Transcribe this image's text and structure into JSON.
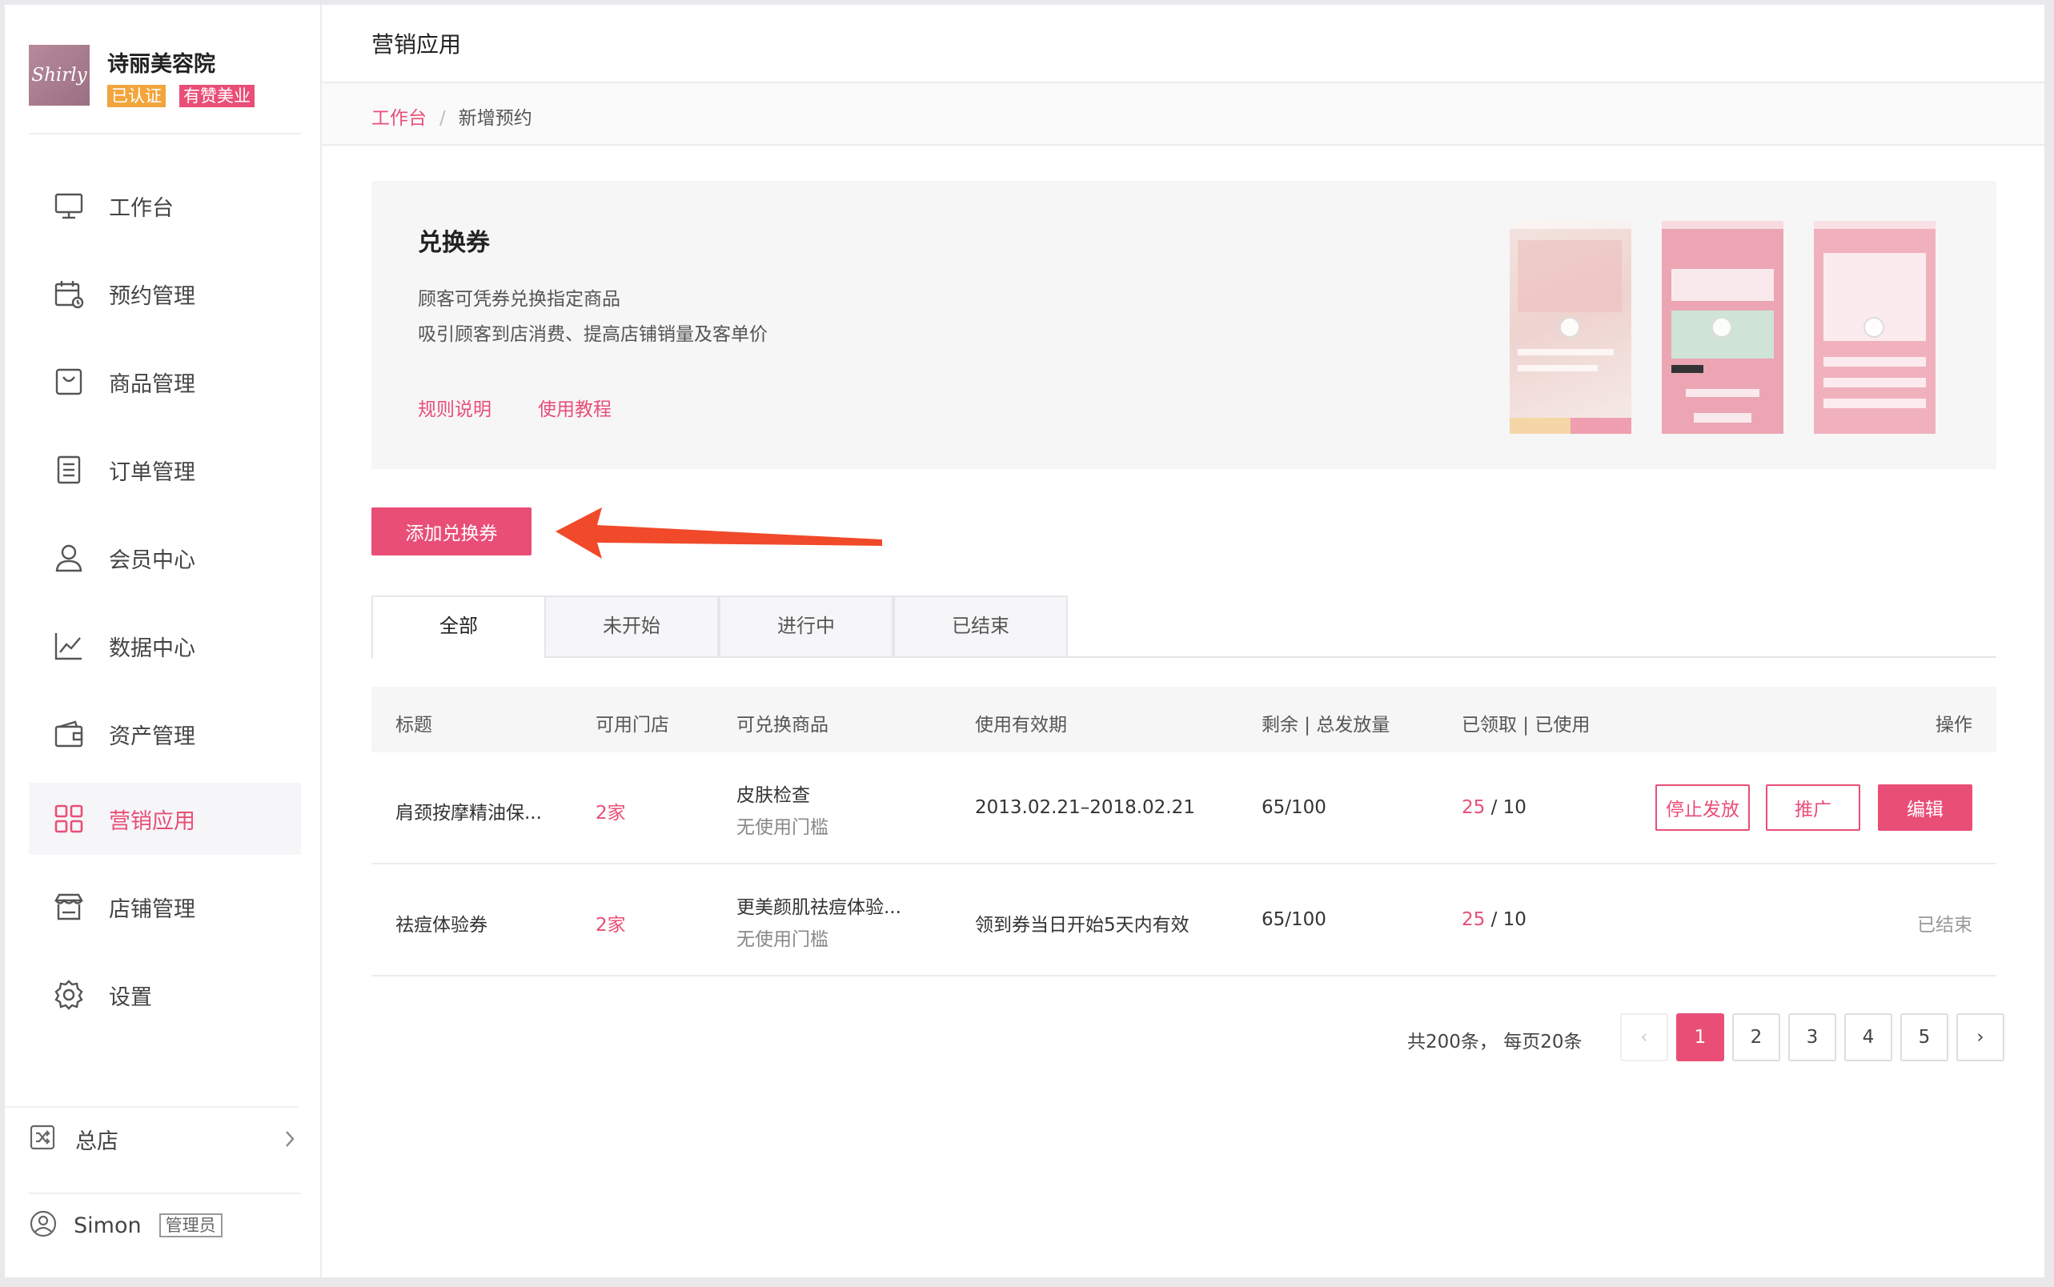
{
  "brand": {
    "logo_text": "Shirly",
    "name": "诗丽美容院",
    "badges": [
      "已认证",
      "有赞美业"
    ]
  },
  "sidebar": {
    "items": [
      {
        "label": "工作台",
        "icon": "monitor-icon"
      },
      {
        "label": "预约管理",
        "icon": "calendar-icon"
      },
      {
        "label": "商品管理",
        "icon": "bag-icon"
      },
      {
        "label": "订单管理",
        "icon": "document-icon"
      },
      {
        "label": "会员中心",
        "icon": "user-icon"
      },
      {
        "label": "数据中心",
        "icon": "chart-icon"
      },
      {
        "label": "资产管理",
        "icon": "wallet-icon"
      },
      {
        "label": "营销应用",
        "icon": "apps-icon",
        "active": true
      },
      {
        "label": "店铺管理",
        "icon": "store-icon"
      },
      {
        "label": "设置",
        "icon": "gear-icon"
      }
    ],
    "store": "总店",
    "user": {
      "name": "Simon",
      "role": "管理员"
    }
  },
  "header": {
    "title": "营销应用"
  },
  "breadcrumb": {
    "home": "工作台",
    "separator": "/",
    "current": "新增预约"
  },
  "intro": {
    "title": "兑换券",
    "desc1": "顾客可凭券兑换指定商品",
    "desc2": "吸引顾客到店消费、提高店铺销量及客单价",
    "link_rules": "规则说明",
    "link_tutorial": "使用教程"
  },
  "add_button": "添加兑换券",
  "tabs": [
    "全部",
    "未开始",
    "进行中",
    "已结束"
  ],
  "table": {
    "headers": [
      "标题",
      "可用门店",
      "可兑换商品",
      "使用有效期",
      "剩余 | 总发放量",
      "已领取 | 已使用",
      "操作"
    ],
    "rows": [
      {
        "title": "肩颈按摩精油保...",
        "stores": "2家",
        "product": "皮肤检查",
        "product_note": "无使用门槛",
        "validity": "2013.02.21–2018.02.21",
        "remaining": "65/100",
        "claimed": "25",
        "used": " / 10",
        "actions": [
          "停止发放",
          "推广",
          "编辑"
        ]
      },
      {
        "title": "祛痘体验券",
        "stores": "2家",
        "product": "更美颜肌祛痘体验...",
        "product_note": "无使用门槛",
        "validity": "领到券当日开始5天内有效",
        "remaining": "65/100",
        "claimed": "25",
        "used": " / 10",
        "status": "已结束"
      }
    ]
  },
  "pagination": {
    "info": "共200条，  每页20条",
    "prev": "‹",
    "pages": [
      "1",
      "2",
      "3",
      "4",
      "5"
    ],
    "next": "›",
    "current": "1"
  },
  "colors": {
    "accent": "#e94e76",
    "badge_orange": "#f2a53c",
    "annotation_arrow": "#f04a2a"
  }
}
